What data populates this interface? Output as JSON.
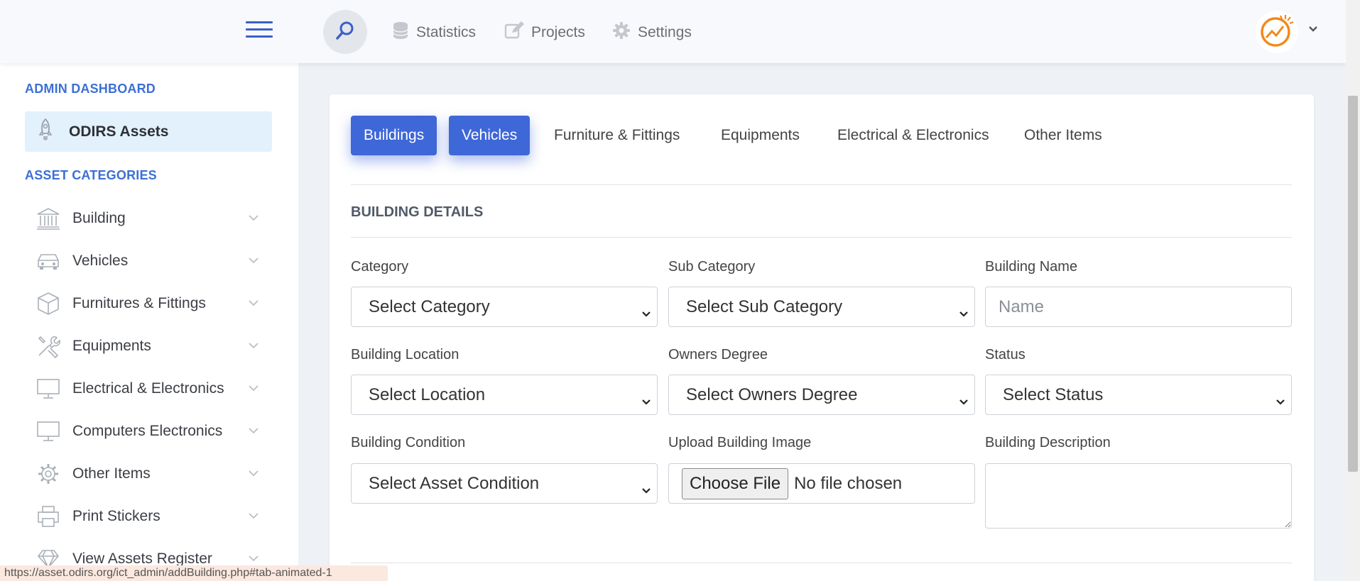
{
  "nav": {
    "items": [
      {
        "label": "Statistics",
        "icon": "database-icon"
      },
      {
        "label": "Projects",
        "icon": "edit-icon"
      },
      {
        "label": "Settings",
        "icon": "gear-icon"
      }
    ]
  },
  "sidebar": {
    "admin_title": "ADMIN DASHBOARD",
    "active_label": "ODIRS Assets",
    "categories_title": "ASSET CATEGORIES",
    "items": [
      {
        "label": "Building",
        "icon": "bank-icon"
      },
      {
        "label": "Vehicles",
        "icon": "car-icon"
      },
      {
        "label": "Furnitures & Fittings",
        "icon": "box-icon"
      },
      {
        "label": "Equipments",
        "icon": "tools-icon"
      },
      {
        "label": "Electrical & Electronics",
        "icon": "monitor-icon"
      },
      {
        "label": "Computers Electronics",
        "icon": "monitor-icon"
      },
      {
        "label": "Other Items",
        "icon": "gear-icon"
      },
      {
        "label": "Print Stickers",
        "icon": "printer-icon"
      },
      {
        "label": "View Assets Register",
        "icon": "diamond-icon"
      }
    ]
  },
  "tabs": [
    {
      "label": "Buildings",
      "active": true
    },
    {
      "label": "Vehicles",
      "active": true
    },
    {
      "label": "Furniture & Fittings",
      "active": false
    },
    {
      "label": "Equipments",
      "active": false
    },
    {
      "label": "Electrical & Electronics",
      "active": false
    },
    {
      "label": "Other Items",
      "active": false
    }
  ],
  "form": {
    "title": "BUILDING DETAILS",
    "category_label": "Category",
    "category_value": "Select Category",
    "subcategory_label": "Sub Category",
    "subcategory_value": "Select Sub Category",
    "name_label": "Building Name",
    "name_placeholder": "Name",
    "location_label": "Building Location",
    "location_value": "Select Location",
    "owners_label": "Owners Degree",
    "owners_value": "Select Owners Degree",
    "status_label": "Status",
    "status_value": "Select Status",
    "condition_label": "Building Condition",
    "condition_value": "Select Asset Condition",
    "image_label": "Upload Building Image",
    "file_button": "Choose File",
    "file_status": "No file chosen",
    "description_label": "Building Description"
  },
  "status_url": "https://asset.odirs.org/ict_admin/addBuilding.php#tab-animated-1",
  "colors": {
    "accent": "#3e67d8",
    "section_title": "#3c6fd6",
    "active_bg": "#e3f1fd",
    "logo_orange": "#f08a1c"
  }
}
